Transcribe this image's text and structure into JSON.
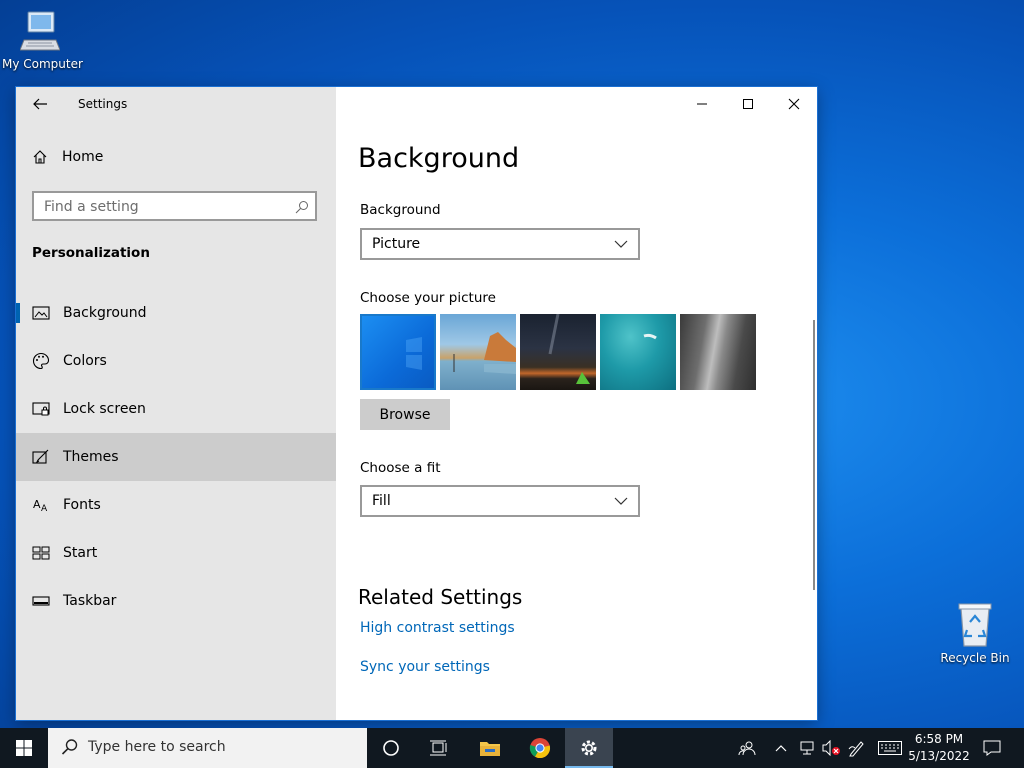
{
  "desktop": {
    "my_computer_label": "My Computer",
    "recycle_bin_label": "Recycle Bin"
  },
  "window": {
    "title": "Settings",
    "controls": [
      "minimize-icon",
      "maximize-icon",
      "close-icon"
    ]
  },
  "sidebar": {
    "home_label": "Home",
    "search_placeholder": "Find a setting",
    "section_title": "Personalization",
    "items": [
      {
        "label": "Background",
        "icon": "picture-icon",
        "selected": true
      },
      {
        "label": "Colors",
        "icon": "palette-icon"
      },
      {
        "label": "Lock screen",
        "icon": "lock-screen-icon"
      },
      {
        "label": "Themes",
        "icon": "themes-icon",
        "hover": true
      },
      {
        "label": "Fonts",
        "icon": "fonts-icon"
      },
      {
        "label": "Start",
        "icon": "start-icon"
      },
      {
        "label": "Taskbar",
        "icon": "taskbar-icon"
      }
    ]
  },
  "main": {
    "page_title": "Background",
    "background_label": "Background",
    "background_value": "Picture",
    "choose_picture_label": "Choose your picture",
    "browse_label": "Browse",
    "fit_label": "Choose a fit",
    "fit_value": "Fill",
    "related_title": "Related Settings",
    "links": [
      "High contrast settings",
      "Sync your settings"
    ]
  },
  "taskbar": {
    "search_placeholder": "Type here to search",
    "time": "6:58 PM",
    "date": "5/13/2022"
  },
  "colors": {
    "accent": "#0063b1",
    "link": "#0067b8",
    "sidebar_bg": "#e6e6e6",
    "taskbar_bg": "#101820"
  }
}
